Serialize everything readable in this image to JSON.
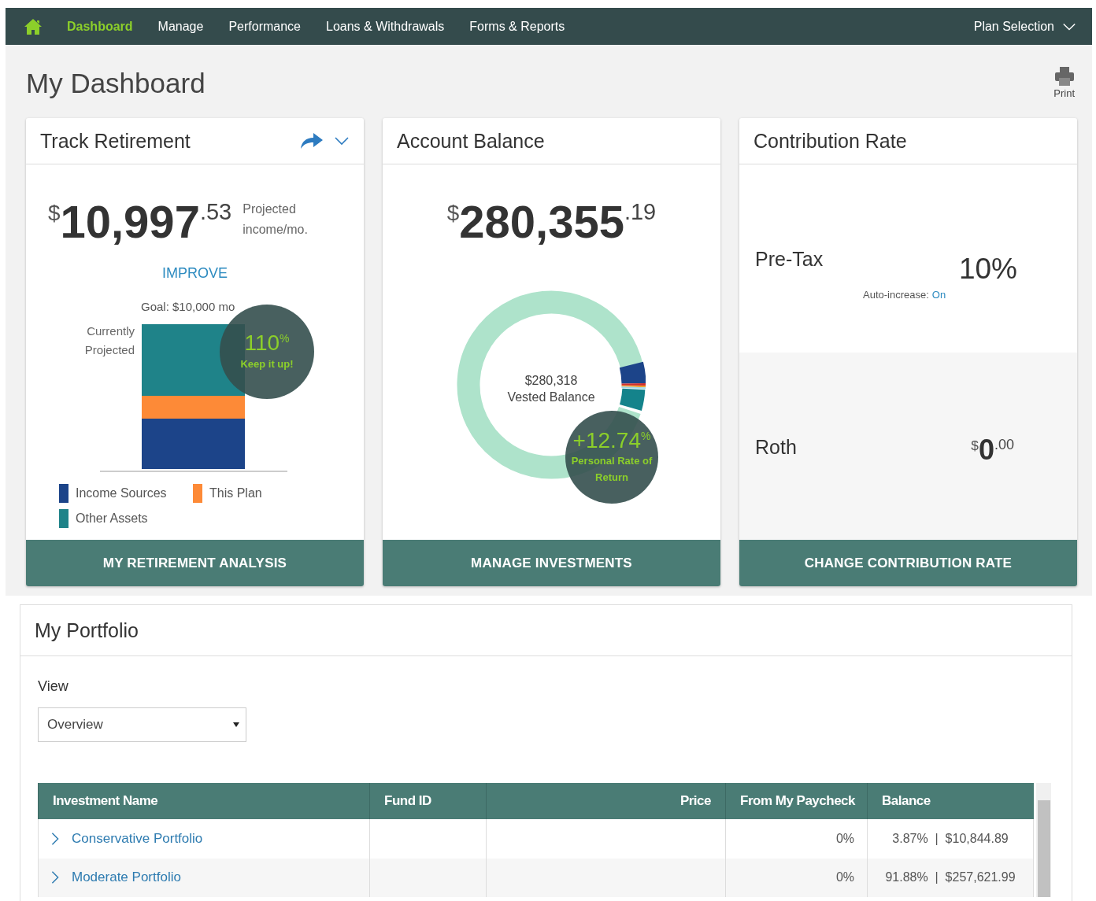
{
  "nav": {
    "items": [
      {
        "label": "Dashboard",
        "selected": true
      },
      {
        "label": "Manage",
        "selected": false
      },
      {
        "label": "Performance",
        "selected": false
      },
      {
        "label": "Loans & Withdrawals",
        "selected": false
      },
      {
        "label": "Forms & Reports",
        "selected": false
      }
    ],
    "plan_selection": "Plan Selection"
  },
  "page_title": "My Dashboard",
  "print_label": "Print",
  "track_retirement": {
    "title": "Track Retirement",
    "amount": {
      "currency": "$",
      "whole": "10,997",
      "cents": ".53"
    },
    "amount_caption": "Projected income/mo.",
    "improve_link": "IMPROVE",
    "goal": "Goal: $10,000 mo",
    "bar_label": "Currently Projected",
    "badge": {
      "value": "110",
      "unit": "%",
      "caption": "Keep it up!"
    },
    "legend": [
      {
        "label": "Income Sources",
        "color": "#1c4489"
      },
      {
        "label": "This Plan",
        "color": "#fd8a37"
      },
      {
        "label": "Other Assets",
        "color": "#1f8389"
      }
    ],
    "button": "MY RETIREMENT ANALYSIS"
  },
  "account_balance": {
    "title": "Account Balance",
    "amount": {
      "currency": "$",
      "whole": "280,355",
      "cents": ".19"
    },
    "center_amount": "$280,318",
    "center_caption": "Vested Balance",
    "badge": {
      "value": "+12.74",
      "unit": "%",
      "caption": "Personal Rate of Return"
    },
    "button": "MANAGE INVESTMENTS"
  },
  "contribution_rate": {
    "title": "Contribution Rate",
    "rows": [
      {
        "kind": "percent",
        "label": "Pre-Tax",
        "value": "10%",
        "note_label": "Auto-increase:",
        "note_value": "On"
      },
      {
        "kind": "amount",
        "label": "Roth",
        "currency": "$",
        "whole": "0",
        "cents": ".00"
      }
    ],
    "button": "CHANGE CONTRIBUTION RATE"
  },
  "portfolio": {
    "title": "My Portfolio",
    "view_label": "View",
    "view_value": "Overview",
    "columns": [
      "Investment Name",
      "Fund ID",
      "Price",
      "From My Paycheck",
      "Balance"
    ],
    "rows": [
      {
        "name": "Conservative Portfolio",
        "paycheck": "0%",
        "balance": "3.87%  |  $10,844.89"
      },
      {
        "name": "Moderate Portfolio",
        "paycheck": "0%",
        "balance": "91.88%  |  $257,621.99"
      }
    ]
  }
}
